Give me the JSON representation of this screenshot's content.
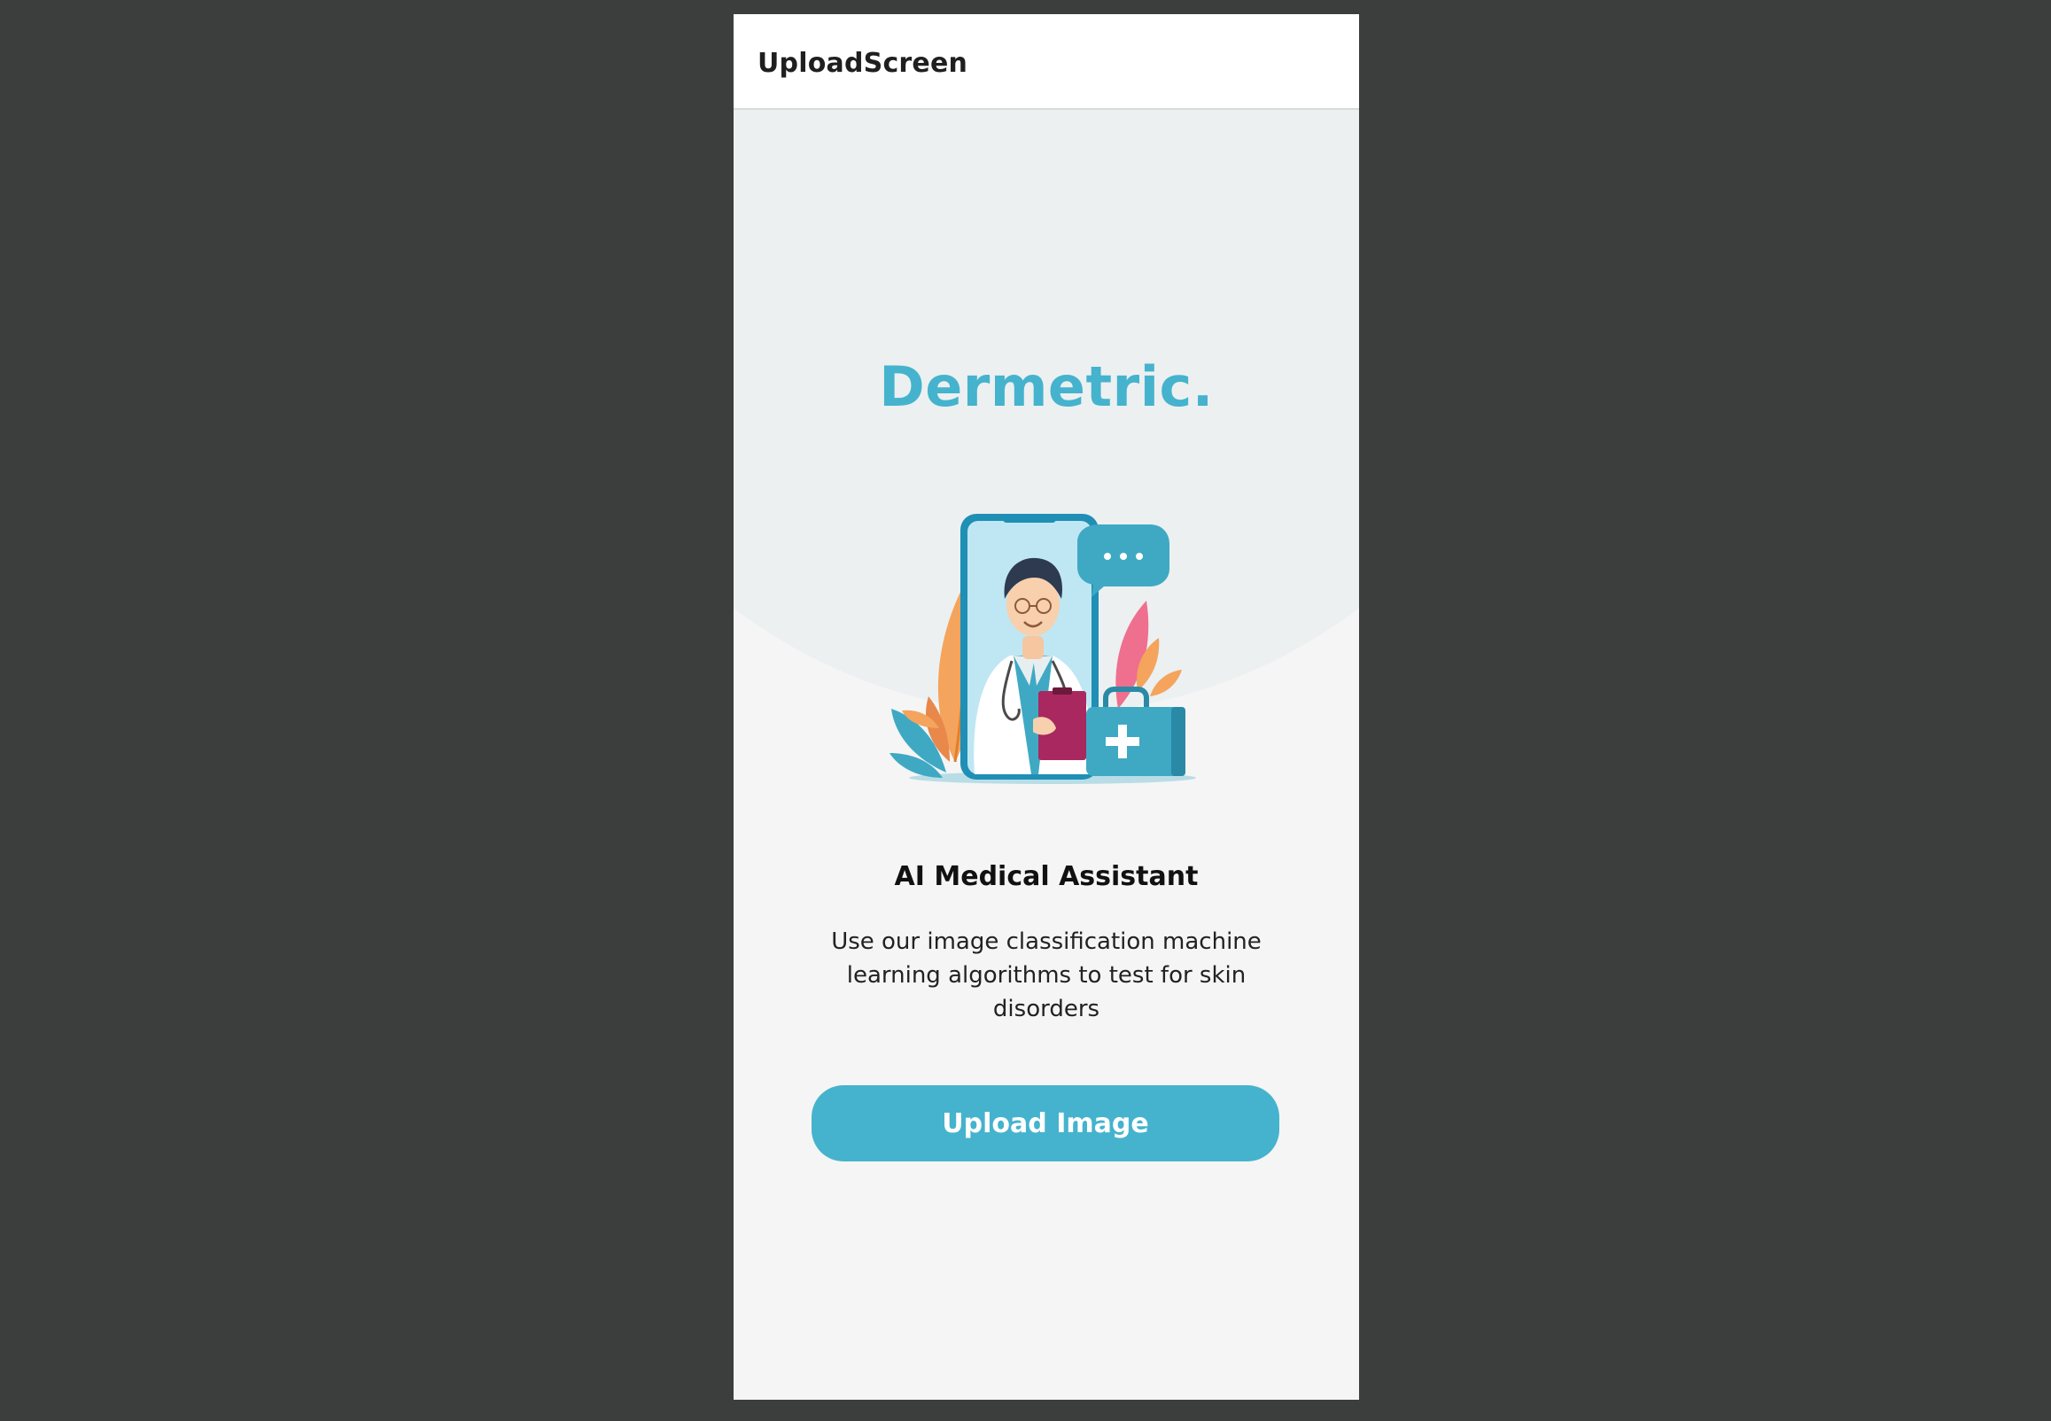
{
  "header": {
    "title": "UploadScreen"
  },
  "hero": {
    "brand": "Dermetric.",
    "illustration_icon": "doctor-illustration-icon"
  },
  "content": {
    "subtitle": "AI Medical Assistant",
    "description": "Use our image classification machine learning algorithms to test for skin disorders"
  },
  "actions": {
    "upload_label": "Upload Image"
  },
  "colors": {
    "accent": "#45b3cd",
    "hero_background": "#ecf0f1",
    "page_background": "#f5f5f5",
    "outer_background": "#3c3d3d"
  }
}
